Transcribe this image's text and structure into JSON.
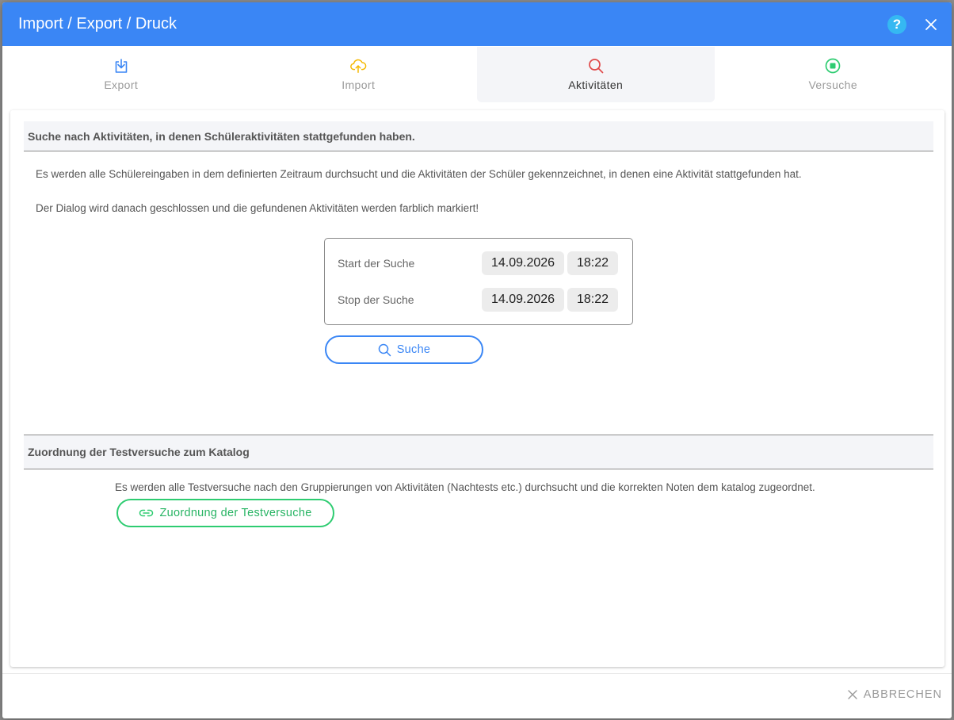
{
  "dialog": {
    "title": "Import / Export / Druck",
    "help_label": "?"
  },
  "tabs": [
    {
      "label": "Export",
      "icon": "download-icon",
      "color": "#3a86f5"
    },
    {
      "label": "Import",
      "icon": "cloud-upload-icon",
      "color": "#f5b800"
    },
    {
      "label": "Aktivitäten",
      "icon": "search-icon",
      "color": "#e04848",
      "active": true
    },
    {
      "label": "Versuche",
      "icon": "stop-circle-icon",
      "color": "#2ecc71"
    }
  ],
  "activities": {
    "header": "Suche nach Aktivitäten, in denen Schüleraktivitäten stattgefunden haben.",
    "description_1": "Es werden alle Schülereingaben in dem definierten Zeitraum durchsucht und die Aktivitäten der Schüler gekennzeichnet, in denen eine Aktivität stattgefunden hat.",
    "description_2": "Der Dialog wird danach geschlossen und die gefundenen Aktivitäten werden farblich markiert!",
    "start_label": "Start der Suche",
    "start_date": "14.09.2026",
    "start_time": "18:22",
    "stop_label": "Stop der Suche",
    "stop_date": "14.09.2026",
    "stop_time": "18:22",
    "search_button": "Suche"
  },
  "assignment": {
    "header": "Zuordnung der Testversuche zum Katalog",
    "description": "Es werden alle Testversuche nach den Gruppierungen von Aktivitäten (Nachtests etc.) durchsucht und die korrekten Noten dem katalog zugeordnet.",
    "button": "Zuordnung der Testversuche"
  },
  "footer": {
    "cancel_label": "ABBRECHEN"
  },
  "colors": {
    "primary": "#3a86f5",
    "help": "#35b8f2",
    "green": "#2ecc71"
  }
}
